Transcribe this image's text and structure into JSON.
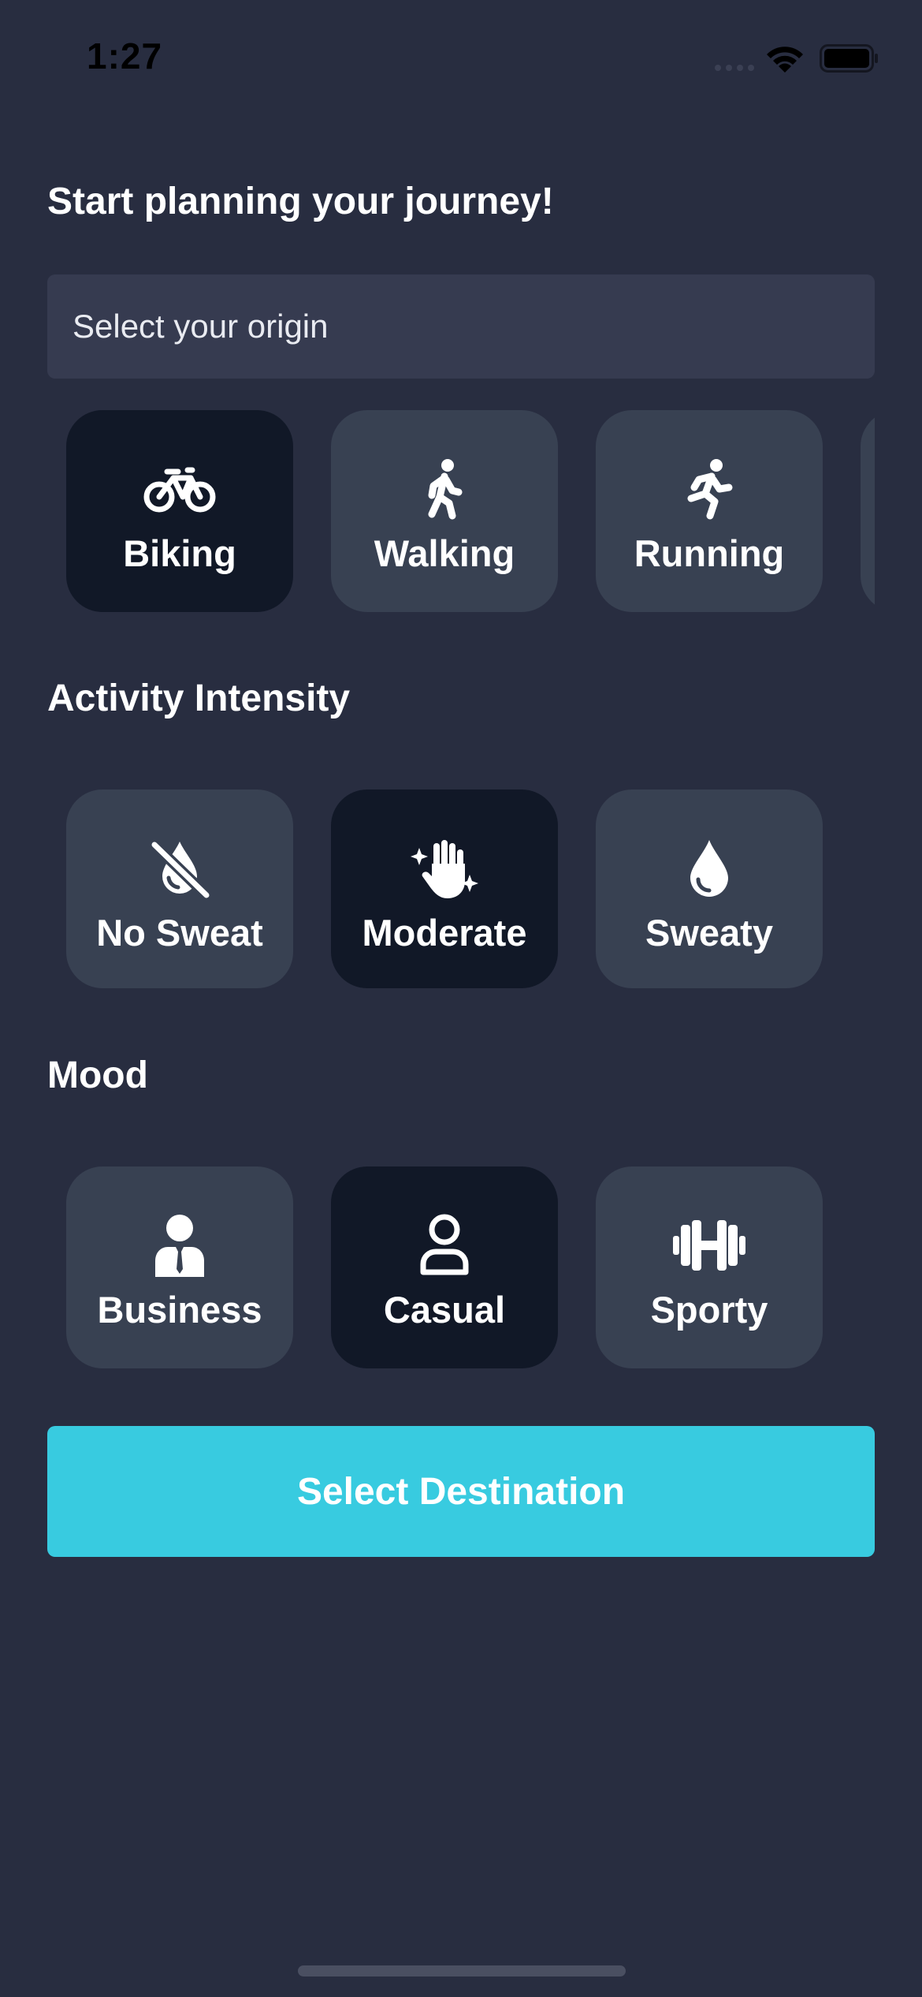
{
  "status": {
    "time": "1:27"
  },
  "page": {
    "title": "Start planning your journey!"
  },
  "origin": {
    "placeholder": "Select your origin",
    "value": ""
  },
  "modes": [
    {
      "label": "Biking",
      "icon": "bicycle-icon",
      "selected": true
    },
    {
      "label": "Walking",
      "icon": "walking-icon",
      "selected": false
    },
    {
      "label": "Running",
      "icon": "running-icon",
      "selected": false
    }
  ],
  "intensity": {
    "title": "Activity Intensity",
    "options": [
      {
        "label": "No Sweat",
        "icon": "no-drop-icon",
        "selected": false
      },
      {
        "label": "Moderate",
        "icon": "sparkle-hand-icon",
        "selected": true
      },
      {
        "label": "Sweaty",
        "icon": "drop-icon",
        "selected": false
      }
    ]
  },
  "mood": {
    "title": "Mood",
    "options": [
      {
        "label": "Business",
        "icon": "business-person-icon",
        "selected": false
      },
      {
        "label": "Casual",
        "icon": "user-outline-icon",
        "selected": true
      },
      {
        "label": "Sporty",
        "icon": "dumbbell-icon",
        "selected": false
      }
    ]
  },
  "cta": {
    "label": "Select Destination"
  },
  "colors": {
    "background": "#282d40",
    "card": "#384152",
    "card_selected": "#111827",
    "accent": "#38cbe0"
  }
}
